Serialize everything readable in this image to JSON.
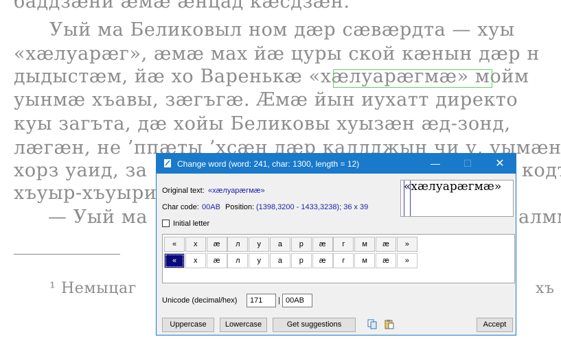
{
  "background": {
    "lines": [
      "баддзæни æмæ æнцад кæсдзæн.",
      "Уый ма Беликовыл ном дæр сæвæрдта — хуы",
      "«хæлуарæг», æмæ мах йæ цуры ской кæнын дæр н",
      "дыдыстæм, йæ хо Варенькæ «хæлуарæгмæ» мойм",
      "уынмæ хъавы, зæгъгæ. Æмæ йын иухатт директо",
      "куы загъта, дæ хойы Беликовы хуызæн æд-зонд,",
      "лæгæн, не ’ппæты ’хсæн дæр каллджын чи у, уымæн т",
      "хорз уаид, за",
      "хъуыр-хъуыри",
      "— Уый ма",
      "¹ Немыцаг"
    ],
    "right_fragments": [
      "кодт",
      "алмм",
      "хъ"
    ]
  },
  "dialog": {
    "title": "Change word (word: 241, char: 1300, length = 12)",
    "title_buttons": {
      "minimize": "—",
      "maximize": "☐",
      "close": "✕"
    },
    "original_text_label": "Original text:",
    "original_text_value": "«хæлуарæгмæ»",
    "char_code_label": "Char code:",
    "char_code_value": "00AB",
    "position_label": "Position:",
    "position_value": "(1398,3200 - 1433,3238); 36 x 39",
    "preview_text": "«хæлуарæгмæ»",
    "initial_letter_label": "Initial letter",
    "initial_letter_checked": false,
    "chars_row1": [
      "«",
      "х",
      "æ",
      "л",
      "у",
      "а",
      "р",
      "æ",
      "г",
      "м",
      "æ",
      "»"
    ],
    "chars_row2": [
      "«",
      "х",
      "æ",
      "л",
      "у",
      "а",
      "р",
      "æ",
      "г",
      "м",
      "æ",
      "»"
    ],
    "selected_index": 0,
    "unicode_label": "Unicode (decimal/hex)",
    "unicode_decimal": "171",
    "unicode_separator": "|",
    "unicode_hex": "00AB",
    "buttons": {
      "uppercase": "Uppercase",
      "lowercase": "Lowercase",
      "suggestions": "Get suggestions",
      "accept": "Accept"
    },
    "icons": [
      "copy-icon",
      "paste-icon"
    ],
    "colors": {
      "titlebar": "#1979ca",
      "value_text": "#1f1fa8",
      "selection": "#0a0a7a"
    }
  }
}
